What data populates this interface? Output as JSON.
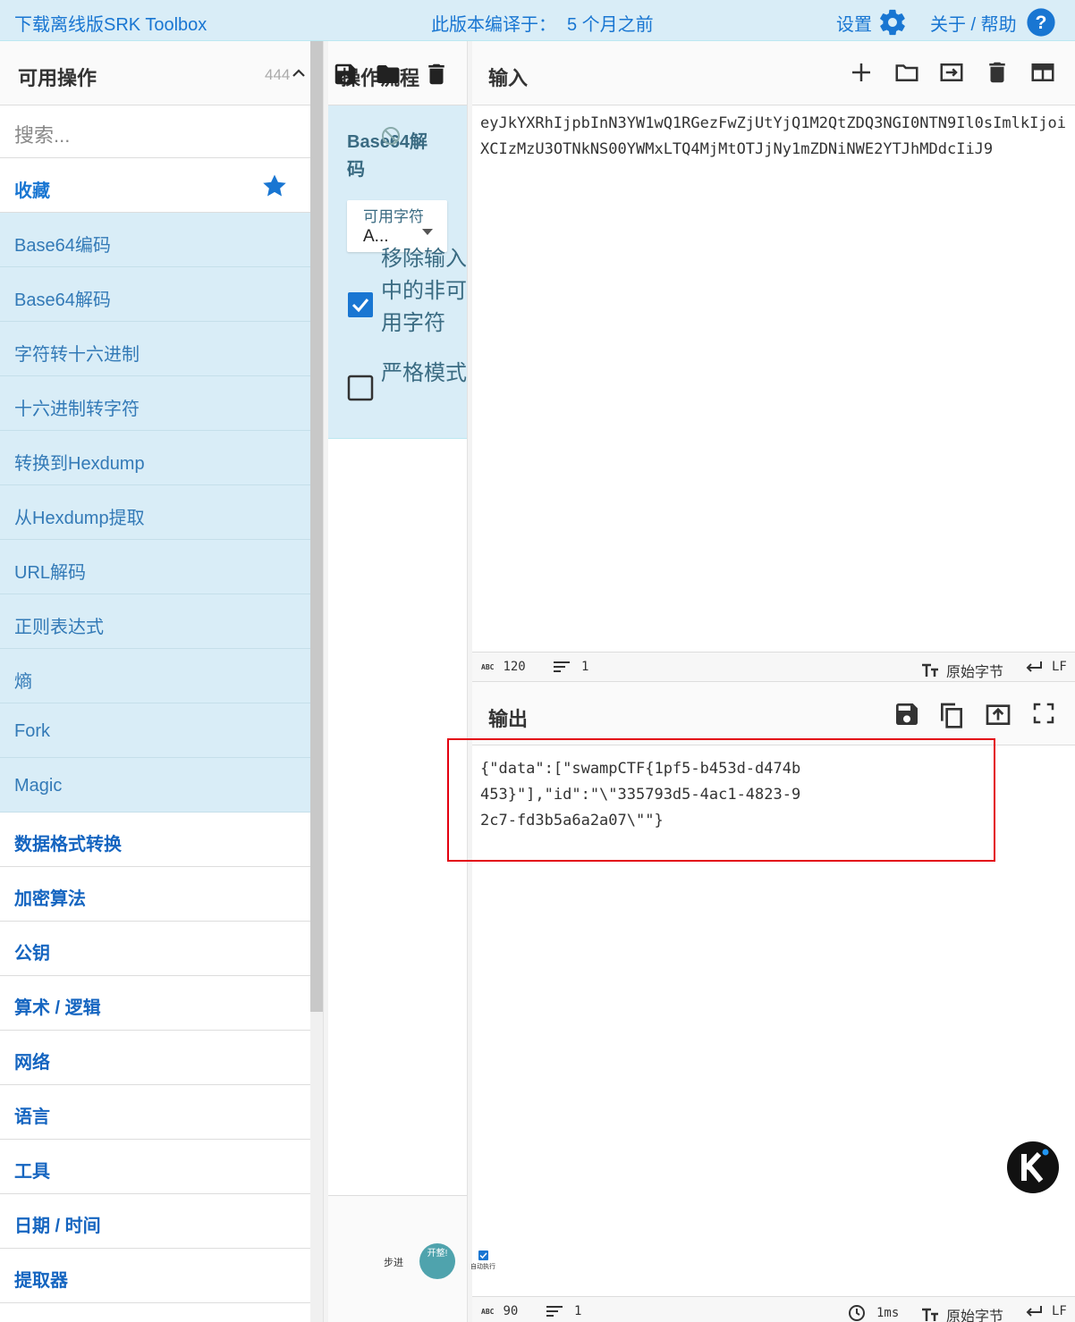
{
  "topbar": {
    "download": "下载离线版SRK Toolbox",
    "version_label": "此版本编译于：",
    "version_value": "5 个月之前",
    "options": "设置",
    "about": "关于 / 帮助"
  },
  "operations": {
    "title": "可用操作",
    "count": "444",
    "search_placeholder": "搜索...",
    "favourites": "收藏",
    "fav_items": [
      "Base64编码",
      "Base64解码",
      "字符转十六进制",
      "十六进制转字符",
      "转换到Hexdump",
      "从Hexdump提取",
      "URL解码",
      "正则表达式",
      "熵",
      "Fork",
      "Magic"
    ],
    "categories": [
      "数据格式转换",
      "加密算法",
      "公钥",
      "算术 / 逻辑",
      "网络",
      "语言",
      "工具",
      "日期 / 时间",
      "提取器"
    ]
  },
  "recipe": {
    "title": "操作流程",
    "op_name": "Base64解码",
    "alphabet_label": "可用字符",
    "alphabet_value": "A...",
    "remove_nonalpha": "移除输入中的非可用字符",
    "remove_nonalpha_checked": true,
    "strict_mode": "严格模式",
    "strict_mode_checked": false,
    "step_label": "步进",
    "bake_label": "开整!",
    "autobake_label": "自动执行"
  },
  "input": {
    "title": "输入",
    "text": "eyJkYXRhIjpbInN3YW1wQ1RGezFwZjUtYjQ1M2QtZDQ3NGI0NTN9Il0sImlkIjoiXCIzMzU3OTNkNS00YWMxLTQ4MjMtOTJjNy1mZDNiNWE2YTJhMDdcIiJ9",
    "status": {
      "abc": "ABC",
      "length": "120",
      "lines": "1",
      "encoding": "原始字节",
      "eol": "LF"
    }
  },
  "output": {
    "title": "输出",
    "text": "{\"data\":[\"swampCTF{1pf5-b453d-d474b453}\"],\"id\":\"\\\"335793d5-4ac1-4823-92c7-fd3b5a6a2a07\\\"\"}",
    "status": {
      "abc": "ABC",
      "length": "90",
      "lines": "1",
      "time": "1ms",
      "encoding": "原始字节",
      "eol": "LF"
    }
  },
  "colors": {
    "accent": "#1976d2",
    "panel": "#d9edf7",
    "highlight": "#e3000f"
  }
}
